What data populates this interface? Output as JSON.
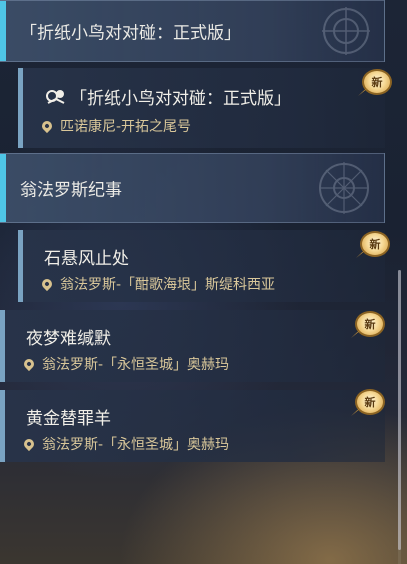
{
  "entries": [
    {
      "kind": "header",
      "label": "「折纸小鸟对对碰：正式版」"
    },
    {
      "kind": "quest",
      "title": "「折纸小鸟对对碰：正式版」",
      "location": "匹诺康尼-开拓之尾号",
      "badge": "新",
      "icon": "event-bird-icon"
    },
    {
      "kind": "header",
      "label": "翁法罗斯纪事"
    },
    {
      "kind": "quest",
      "title": "石悬风止处",
      "location": "翁法罗斯-「酣歌海垠」斯缇科西亚",
      "badge": "新"
    },
    {
      "kind": "quest",
      "title": "夜梦难缄默",
      "location": "翁法罗斯-「永恒圣城」奥赫玛",
      "badge": "新"
    },
    {
      "kind": "quest",
      "title": "黄金替罪羊",
      "location": "翁法罗斯-「永恒圣城」奥赫玛",
      "badge": "新"
    }
  ],
  "colors": {
    "accent": "#4fc6e6",
    "location_text": "#d9c79a",
    "badge_gold": "#f6d996"
  }
}
